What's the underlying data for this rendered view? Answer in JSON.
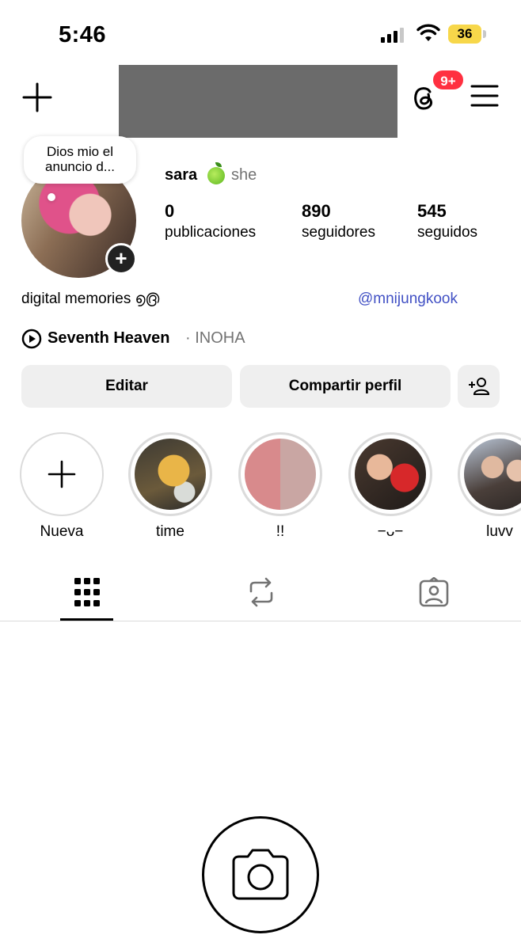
{
  "status_bar": {
    "time": "5:46",
    "battery": "36"
  },
  "header": {
    "notification_badge": "9+"
  },
  "profile": {
    "note": "Dios mio el anuncio d...",
    "name": "sara",
    "pronouns": "she",
    "stats": [
      {
        "value": "0",
        "label": "publicaciones"
      },
      {
        "value": "890",
        "label": "seguidores"
      },
      {
        "value": "545",
        "label": "seguidos"
      }
    ],
    "bio": "digital memories ൭൫",
    "mention": "@mnijungkook",
    "music": {
      "song": "Seventh Heaven",
      "artist": "· INOHA"
    }
  },
  "buttons": {
    "edit": "Editar",
    "share": "Compartir perfil"
  },
  "highlights": [
    {
      "label": "Nueva"
    },
    {
      "label": "time"
    },
    {
      "label": "!!"
    },
    {
      "label": "−ᴗ−"
    },
    {
      "label": "luvv"
    }
  ],
  "colors": {
    "accent_link": "#4150c4",
    "badge": "#ff3040",
    "button_bg": "#efefef"
  }
}
